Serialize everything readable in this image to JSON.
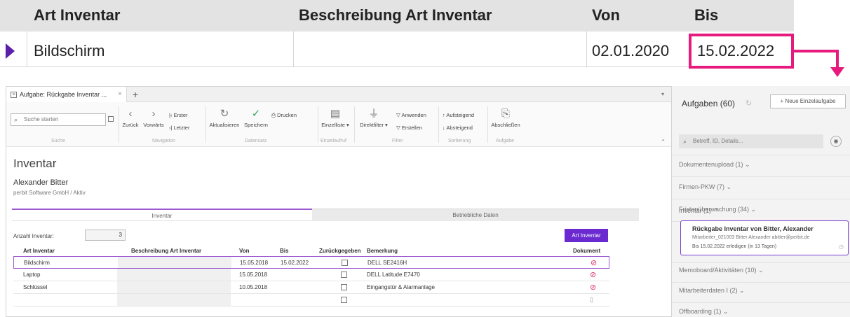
{
  "zoom": {
    "headers": [
      "Art Inventar",
      "Beschreibung Art Inventar",
      "Von",
      "Bis"
    ],
    "row": {
      "art": "Bildschirm",
      "beschreibung": "",
      "von": "02.01.2020",
      "bis": "15.02.2022"
    },
    "highlight_color": "#e6197d",
    "row_indicator_color": "#5b1fa8"
  },
  "tab": {
    "title": "Aufgabe: Rückgabe Inventar ...",
    "close": "×",
    "add": "+"
  },
  "ribbon": {
    "search_placeholder": "Suche starten",
    "groups": {
      "search": "Suche",
      "navigation": "Navigation",
      "datensatz": "Datensatz",
      "einzelaufruf": "Einzelaufruf",
      "filter": "Filter",
      "sortierung": "Sortierung",
      "aufgabe": "Aufgabe"
    },
    "buttons": {
      "zurueck": "Zurück",
      "vorwaerts": "Vorwärts",
      "erster": "Erster",
      "letzter": "Letzter",
      "aktualisieren": "Aktualisieren",
      "speichern": "Speichern",
      "drucken": "Drucken",
      "einzelliste": "Einzelliste ▾",
      "direktfilter": "Direktfilter ▾",
      "anwenden": "Anwenden",
      "erstellen": "Erstellen",
      "aufsteigend": "Aufsteigend",
      "absteigend": "Absteigend",
      "abschliessen": "Abschließen"
    }
  },
  "page": {
    "title": "Inventar",
    "person": "Alexander Bitter",
    "company": "perbit Software GmbH / Aktiv"
  },
  "inner_tabs": [
    "Inventar",
    "Betriebliche Daten"
  ],
  "count": {
    "label": "Anzahl Inventar:",
    "value": "3"
  },
  "art_button": "Art Inventar",
  "table": {
    "headers": [
      "Art Inventar",
      "Beschreibung Art Inventar",
      "Von",
      "Bis",
      "Zurückgegeben",
      "Bemerkung",
      "Dokument"
    ],
    "rows": [
      {
        "art": "Bildschirm",
        "von": "15.05.2018",
        "bis": "15.02.2022",
        "bemerkung": "DELL SE2416H"
      },
      {
        "art": "Laptop",
        "von": "15.05.2018",
        "bis": "",
        "bemerkung": "DELL Latitude E7470"
      },
      {
        "art": "Schlüssel",
        "von": "10.05.2018",
        "bis": "",
        "bemerkung": "Eingangstür & Alarmanlage"
      },
      {
        "art": "",
        "von": "",
        "bis": "",
        "bemerkung": ""
      }
    ]
  },
  "panel": {
    "title": "Aufgaben (60)",
    "new_button": "+ Neue Einzelaufgabe",
    "search_placeholder": "Betreff, ID, Details...",
    "groups": [
      "Dokumentenupload (1) ⌄",
      "Firmen-PKW (7) ⌄",
      "Fristenüberwachung (34) ⌄",
      "Inventar (1) ⌃",
      "Memoboard/Aktivitäten (10) ⌄",
      "Mitarbeiterdaten I (2) ⌄",
      "Offboarding (1) ⌄"
    ],
    "card": {
      "title": "Rückgabe Inventar von Bitter, Alexander",
      "line2": "Mitarbeiter_021003 Bitter Alexander abitter@perbit.de",
      "line3": "Bis 15.02.2022 erledigen (in 13 Tagen)"
    }
  }
}
